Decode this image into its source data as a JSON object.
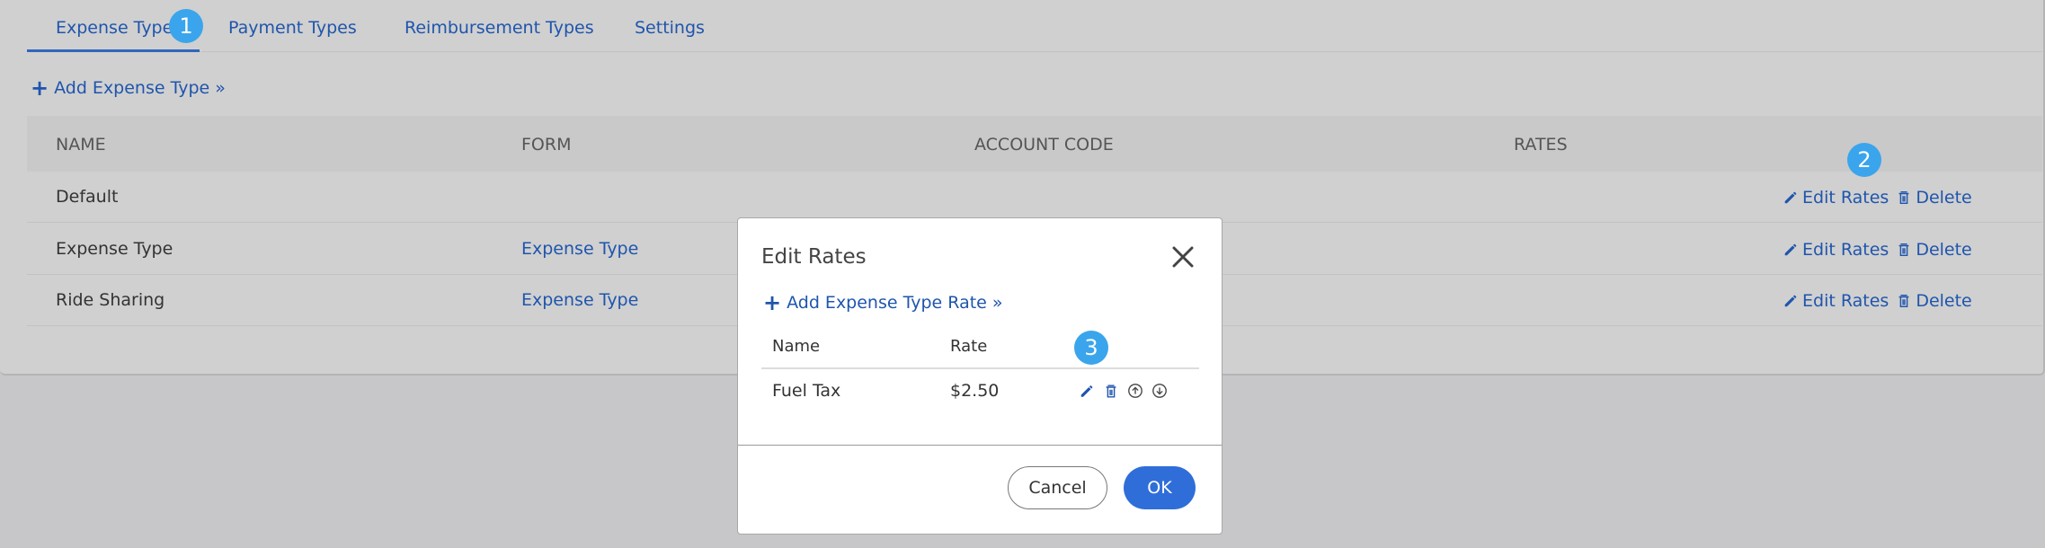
{
  "tabs": [
    {
      "label": "Expense Types",
      "active": true
    },
    {
      "label": "Payment Types"
    },
    {
      "label": "Reimbursement Types"
    },
    {
      "label": "Settings"
    }
  ],
  "badges": {
    "one": "1",
    "two": "2",
    "three": "3"
  },
  "add_expense_type": "Add Expense Type »",
  "table": {
    "headers": {
      "name": "NAME",
      "form": "FORM",
      "account_code": "ACCOUNT CODE",
      "rates": "RATES"
    },
    "rows": [
      {
        "name": "Default",
        "form": ""
      },
      {
        "name": "Expense Type",
        "form": "Expense Type"
      },
      {
        "name": "Ride Sharing",
        "form": "Expense Type"
      }
    ],
    "edit_rates_label": "Edit Rates",
    "delete_label": "Delete"
  },
  "modal": {
    "title": "Edit Rates",
    "add_rate": "Add Expense Type Rate »",
    "columns": {
      "name": "Name",
      "rate": "Rate"
    },
    "rows": [
      {
        "name": "Fuel Tax",
        "rate": "$2.50"
      }
    ],
    "cancel_label": "Cancel",
    "ok_label": "OK"
  },
  "colors": {
    "accent": "#1f55ad",
    "primary_button": "#2f6ed9",
    "badge": "#3aa5ec",
    "overlay": "#c7c7c9"
  }
}
